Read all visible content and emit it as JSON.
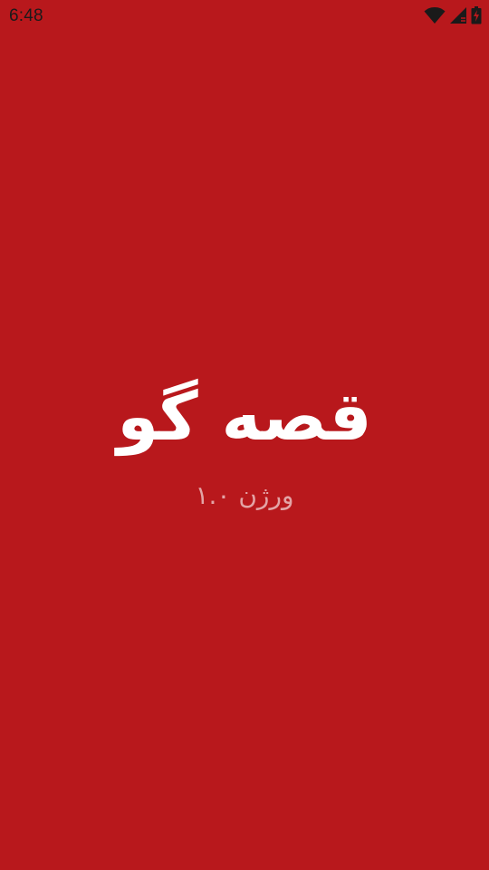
{
  "status_bar": {
    "time": "6:48",
    "icons": [
      "wifi-icon",
      "cellular-signal-icon",
      "battery-charging-icon"
    ]
  },
  "splash": {
    "title": "قصه گو",
    "version": "ورژن ۱.۰"
  },
  "colors": {
    "background": "#b8181c",
    "title": "#ffffff",
    "version_text": "#e3a4a6",
    "status_icons": "#1a1a1a"
  }
}
